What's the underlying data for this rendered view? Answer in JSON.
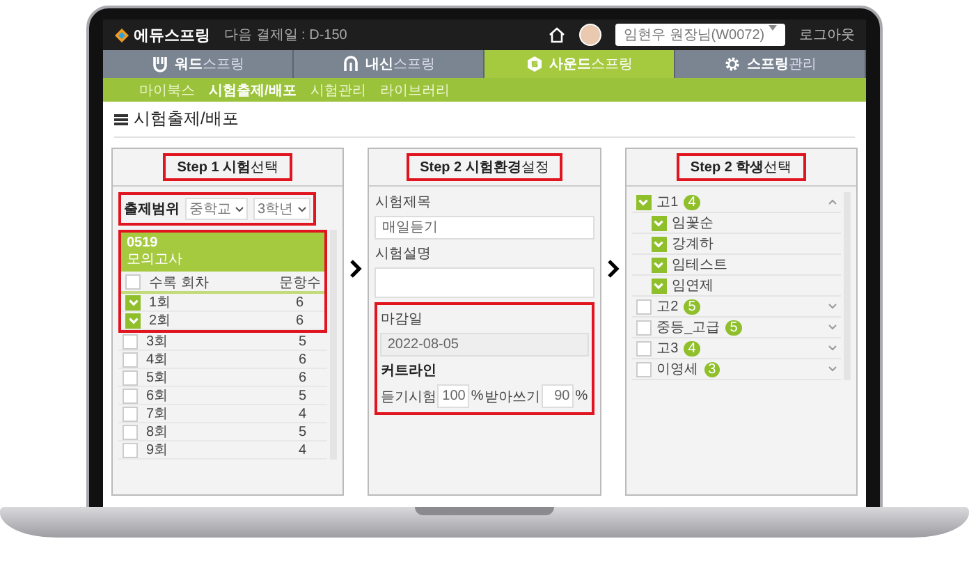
{
  "header": {
    "logo": "에듀스프링",
    "billing": "다음 결제일 : D-150",
    "user": "임현우 원장님(W0072)",
    "logout": "로그아웃"
  },
  "nav": [
    {
      "label": "**워드**스프링",
      "kind": "word",
      "selected": false
    },
    {
      "label": "**내신**스프링",
      "kind": "school",
      "selected": false
    },
    {
      "label": "**사운드**스프링",
      "kind": "sound",
      "selected": true
    },
    {
      "label": "**스프링**관리",
      "kind": "settings",
      "selected": false
    }
  ],
  "subnav": [
    {
      "label": "마이북스",
      "selected": false
    },
    {
      "label": "시험출제/배포",
      "selected": true
    },
    {
      "label": "시험관리",
      "selected": false
    },
    {
      "label": "라이브러리",
      "selected": false
    }
  ],
  "page_title": "시험출제/배포",
  "step1": {
    "title": "**Step 1 시험**선택",
    "filter_label": "출제범위",
    "selects": [
      "중학교",
      "3학년"
    ],
    "group_code": "0519",
    "group_name": "모의고사",
    "columns": [
      "수록 회차",
      "문항수"
    ],
    "all_checked": false,
    "rows": [
      {
        "label": "1회",
        "count": "6",
        "checked": true
      },
      {
        "label": "2회",
        "count": "6",
        "checked": true
      },
      {
        "label": "3회",
        "count": "5",
        "checked": false
      },
      {
        "label": "4회",
        "count": "6",
        "checked": false
      },
      {
        "label": "5회",
        "count": "6",
        "checked": false
      },
      {
        "label": "6회",
        "count": "5",
        "checked": false
      },
      {
        "label": "7회",
        "count": "4",
        "checked": false
      },
      {
        "label": "8회",
        "count": "5",
        "checked": false
      },
      {
        "label": "9회",
        "count": "4",
        "checked": false
      }
    ]
  },
  "step2": {
    "title": "**Step 2 시험환경**설정",
    "name_label": "시험제목",
    "name_value": "매일듣기",
    "desc_label": "시험설명",
    "due_label": "마감일",
    "due_value": "2022-08-05",
    "cutline_label": "커트라인",
    "cutlines": [
      {
        "label": "듣기시험",
        "value": "100",
        "unit": "%"
      },
      {
        "label": "받아쓰기",
        "value": "90",
        "unit": "%"
      }
    ]
  },
  "step3": {
    "title": "**Step 2 학생**선택",
    "groups": [
      {
        "name": "고1",
        "count": "4",
        "checked": true,
        "expanded": true,
        "children": [
          {
            "name": "임꽃순",
            "checked": true
          },
          {
            "name": "강계하",
            "checked": true
          },
          {
            "name": "임테스트",
            "checked": true
          },
          {
            "name": "임연제",
            "checked": true
          }
        ]
      },
      {
        "name": "고2",
        "count": "5",
        "checked": false,
        "expanded": false
      },
      {
        "name": "중등_고급",
        "count": "5",
        "checked": false,
        "expanded": false
      },
      {
        "name": "고3",
        "count": "4",
        "checked": false,
        "expanded": false
      },
      {
        "name": "이영세",
        "count": "3",
        "checked": false,
        "expanded": false
      }
    ]
  }
}
